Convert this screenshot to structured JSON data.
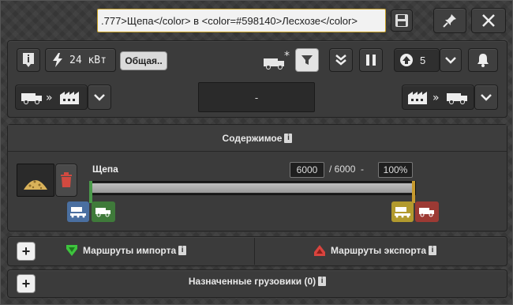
{
  "header": {
    "name_field_value": ".777>Щепа</color> в <color=#598140>Лесхозе</color>",
    "save_icon": "floppy-icon",
    "pin_icon": "pin-icon",
    "close_icon": "close-icon"
  },
  "toolbar": {
    "info_icon": "info-icon",
    "power_label": "24 кВт",
    "group_label": "Общая..",
    "queue_count": "5",
    "buttons": [
      "truck-settings",
      "filter",
      "collapse",
      "pause",
      "priority-up",
      "dropdown",
      "notify"
    ]
  },
  "mode_row": {
    "left_mode": "truck-to-factory",
    "center_value": "-",
    "right_mode": "factory-to-truck"
  },
  "contents": {
    "title": "Содержимое",
    "item_name": "Щепа",
    "current": "6000",
    "separator": "/ 6000  -",
    "max_percent": "100%",
    "fill_fraction": 1.0
  },
  "routes": {
    "import_label": "Маршруты импорта",
    "export_label": "Маршруты экспорта",
    "add_label": "+"
  },
  "trucks": {
    "label": "Назначенные грузовики (0)",
    "add_label": "+"
  },
  "colors": {
    "import_green": "#3ec43e",
    "export_red": "#d9443e",
    "unload_blue": "#4a6fa0",
    "load_green": "#3f7a3a",
    "marker_yellow": "#b29a2e",
    "marker_red": "#9c3a34"
  }
}
